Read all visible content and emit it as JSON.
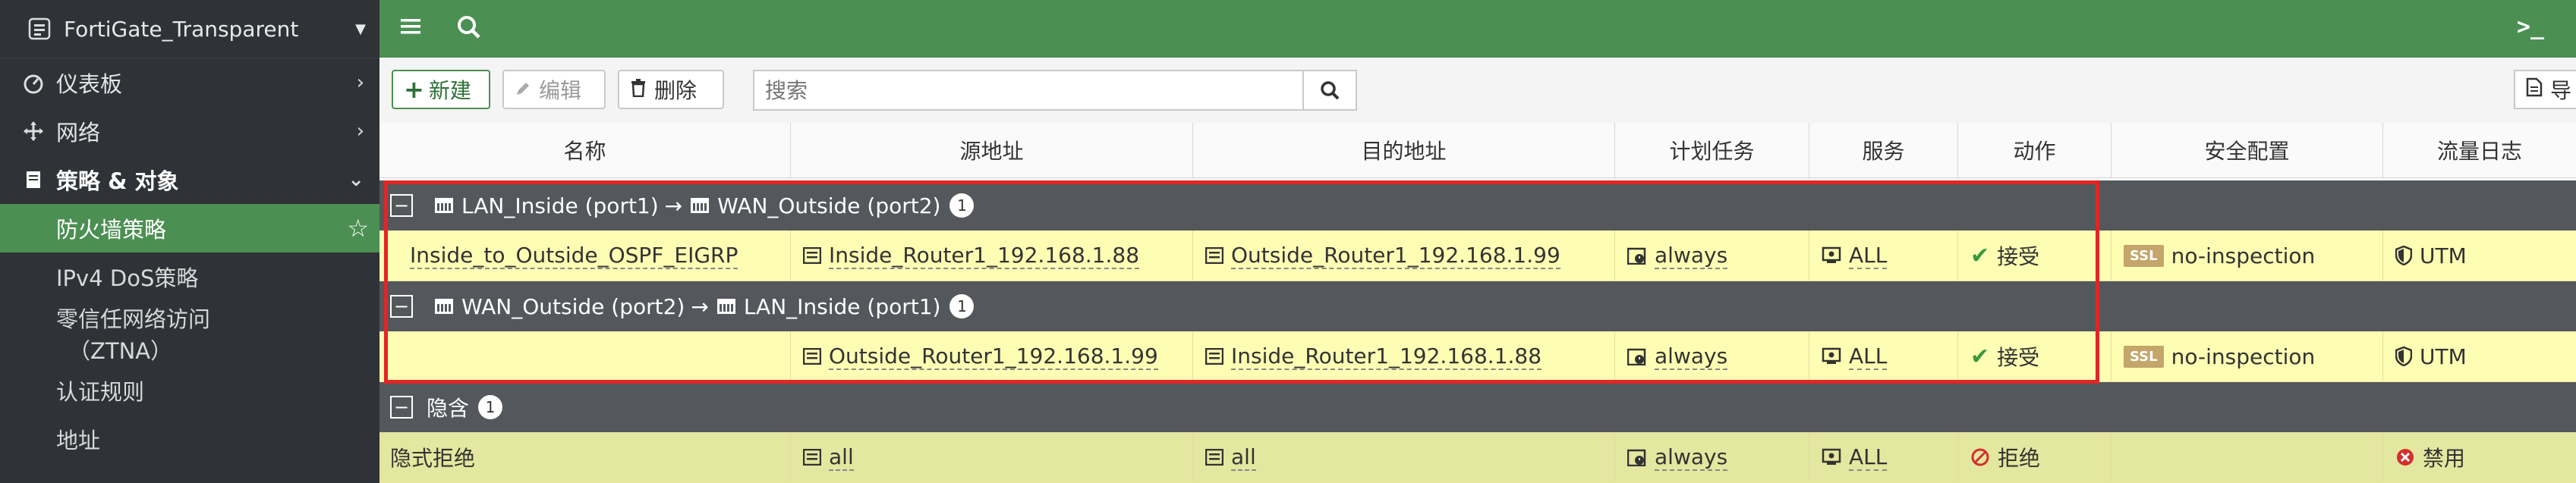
{
  "sidebar": {
    "device": "FortiGate_Transparent",
    "items": [
      {
        "label": "仪表板"
      },
      {
        "label": "网络"
      },
      {
        "label": "策略 & 对象"
      }
    ],
    "sub_items": [
      {
        "label": "防火墙策略"
      },
      {
        "label": "IPv4 DoS策略"
      },
      {
        "label": "零信任网络访问",
        "label2": "（ZTNA）"
      },
      {
        "label": "认证规则"
      },
      {
        "label": "地址"
      }
    ]
  },
  "toolbar": {
    "new_label": "新建",
    "edit_label": "编辑",
    "delete_label": "删除",
    "search_placeholder": "搜索",
    "export_label": "导"
  },
  "columns": [
    "名称",
    "源地址",
    "目的地址",
    "计划任务",
    "服务",
    "动作",
    "安全配置",
    "流量日志"
  ],
  "groups": [
    {
      "src_if": "LAN_Inside (port1)",
      "arrow": "→",
      "dst_if": "WAN_Outside (port2)",
      "count": "1",
      "row": {
        "name": "Inside_to_Outside_OSPF_EIGRP",
        "src": "Inside_Router1_192.168.1.88",
        "dst": "Outside_Router1_192.168.1.99",
        "schedule": "always",
        "service": "ALL",
        "action": "接受",
        "ssl": "SSL",
        "security": "no-inspection",
        "log": "UTM"
      }
    },
    {
      "src_if": "WAN_Outside (port2)",
      "arrow": "→",
      "dst_if": "LAN_Inside (port1)",
      "count": "1",
      "row": {
        "name": "",
        "src": "Outside_Router1_192.168.1.99",
        "dst": "Inside_Router1_192.168.1.88",
        "schedule": "always",
        "service": "ALL",
        "action": "接受",
        "ssl": "SSL",
        "security": "no-inspection",
        "log": "UTM"
      }
    }
  ],
  "implicit": {
    "label": "隐含",
    "count": "1",
    "row": {
      "name": "隐式拒绝",
      "src": "all",
      "dst": "all",
      "schedule": "always",
      "service": "ALL",
      "action": "拒绝",
      "log": "禁用"
    }
  },
  "colors": {
    "brand_green": "#4b8f52",
    "sidebar_bg": "#2f3237",
    "group_header": "#54575c",
    "row_yellow": "#fdfdb3",
    "highlight_red": "#e02626"
  },
  "icons": [
    "hamburger-icon",
    "search-icon",
    "terminal-icon",
    "dashboard-icon",
    "network-icon",
    "policy-icon",
    "star-icon",
    "plus-icon",
    "pencil-icon",
    "trash-icon",
    "address-icon",
    "schedule-icon",
    "service-icon",
    "check-icon",
    "deny-icon",
    "shield-icon",
    "disabled-icon"
  ]
}
